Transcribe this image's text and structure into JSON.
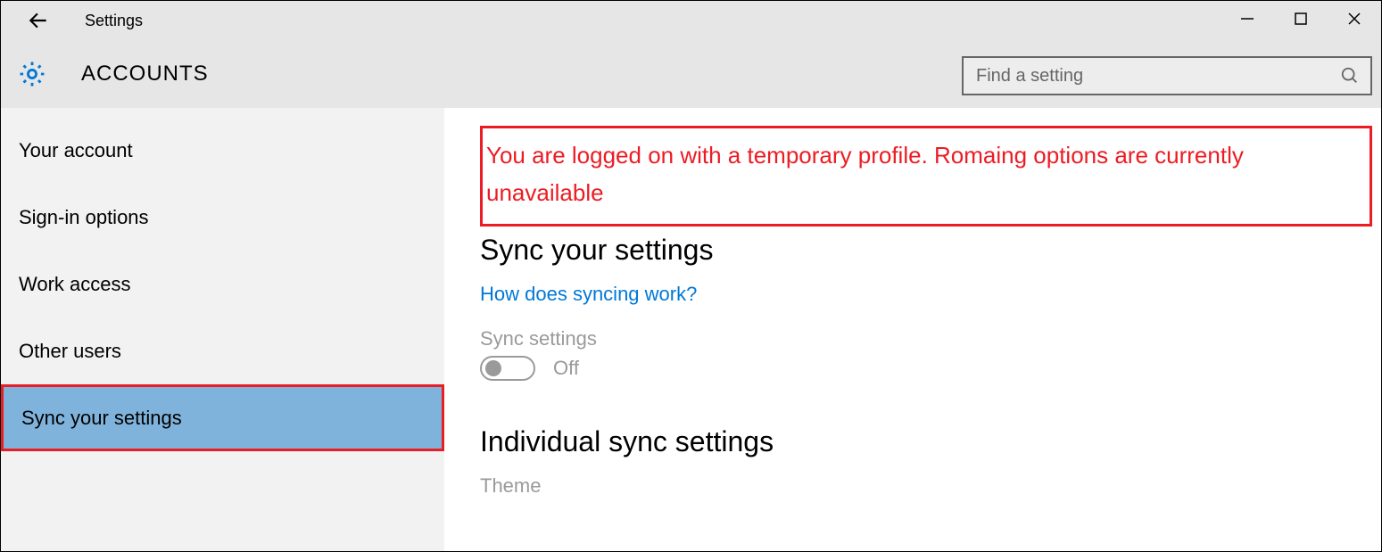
{
  "titlebar": {
    "title": "Settings"
  },
  "header": {
    "section": "ACCOUNTS",
    "search_placeholder": "Find a setting"
  },
  "sidebar": {
    "items": [
      {
        "label": "Your account",
        "selected": false
      },
      {
        "label": "Sign-in options",
        "selected": false
      },
      {
        "label": "Work access",
        "selected": false
      },
      {
        "label": "Other users",
        "selected": false
      },
      {
        "label": "Sync your settings",
        "selected": true
      }
    ]
  },
  "content": {
    "warning": "You are logged on with a temporary profile. Romaing options are currently unavailable",
    "heading_sync": "Sync your settings",
    "link_how": "How does syncing work?",
    "label_sync_settings": "Sync settings",
    "toggle_state": "Off",
    "heading_individual": "Individual sync settings",
    "label_theme": "Theme"
  }
}
